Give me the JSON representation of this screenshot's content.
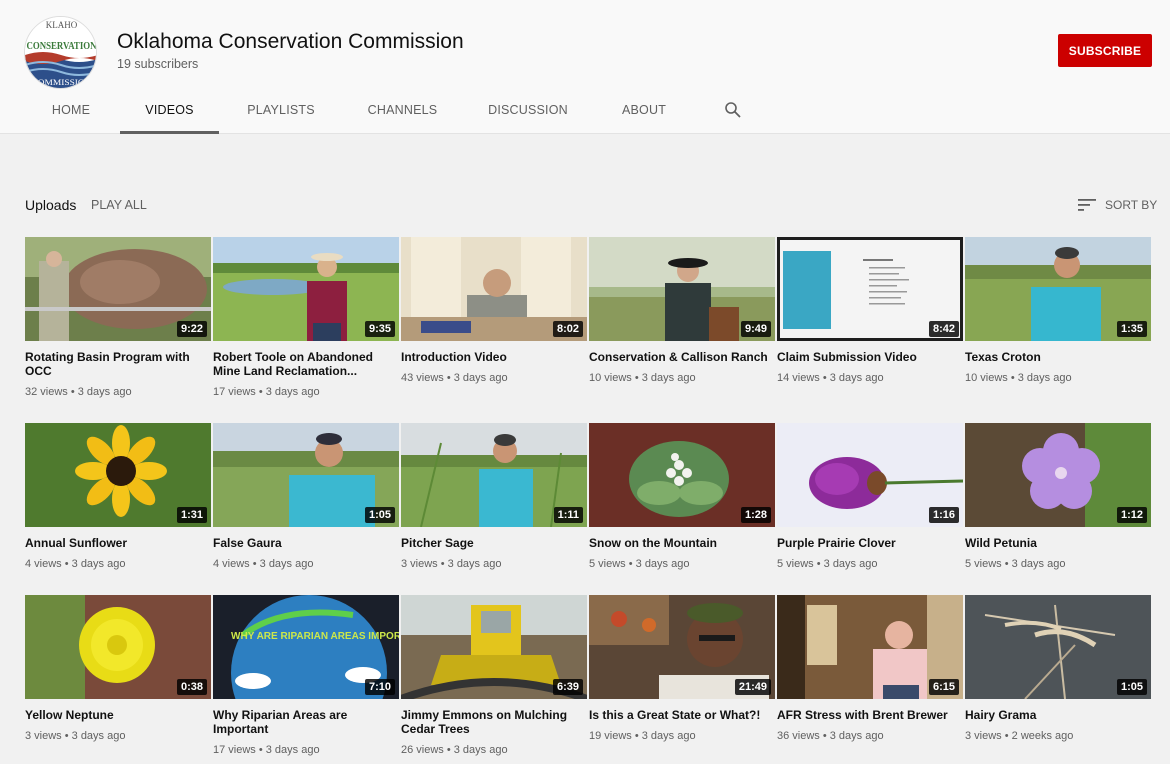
{
  "channel": {
    "logo_text_top": "KLAHO",
    "logo_text_mid": "CONSERVATION",
    "logo_text_bottom": "COMMISSION",
    "name": "Oklahoma Conservation Commission",
    "subscribers": "19 subscribers",
    "subscribe_label": "SUBSCRIBE"
  },
  "tabs": [
    {
      "label": "HOME"
    },
    {
      "label": "VIDEOS"
    },
    {
      "label": "PLAYLISTS"
    },
    {
      "label": "CHANNELS"
    },
    {
      "label": "DISCUSSION"
    },
    {
      "label": "ABOUT"
    }
  ],
  "uploads": {
    "title": "Uploads",
    "play_all": "PLAY ALL",
    "sort_by": "SORT BY"
  },
  "videos": [
    {
      "title": "Rotating Basin Program with OCC",
      "duration": "9:22",
      "meta": "32 views • 3 days ago"
    },
    {
      "title": "Robert Toole on Abandoned Mine Land Reclamation...",
      "duration": "9:35",
      "meta": "17 views • 3 days ago"
    },
    {
      "title": "Introduction Video",
      "duration": "8:02",
      "meta": "43 views • 3 days ago"
    },
    {
      "title": "Conservation & Callison Ranch",
      "duration": "9:49",
      "meta": "10 views • 3 days ago"
    },
    {
      "title": "Claim Submission Video",
      "duration": "8:42",
      "meta": "14 views • 3 days ago"
    },
    {
      "title": "Texas Croton",
      "duration": "1:35",
      "meta": "10 views • 3 days ago"
    },
    {
      "title": "Annual Sunflower",
      "duration": "1:31",
      "meta": "4 views • 3 days ago"
    },
    {
      "title": "False Gaura",
      "duration": "1:05",
      "meta": "4 views • 3 days ago"
    },
    {
      "title": "Pitcher Sage",
      "duration": "1:11",
      "meta": "3 views • 3 days ago"
    },
    {
      "title": "Snow on the Mountain",
      "duration": "1:28",
      "meta": "5 views • 3 days ago"
    },
    {
      "title": "Purple Prairie Clover",
      "duration": "1:16",
      "meta": "5 views • 3 days ago"
    },
    {
      "title": "Wild Petunia",
      "duration": "1:12",
      "meta": "5 views • 3 days ago"
    },
    {
      "title": "Yellow Neptune",
      "duration": "0:38",
      "meta": "3 views • 3 days ago"
    },
    {
      "title": "Why Riparian Areas are Important",
      "duration": "7:10",
      "meta": "17 views • 3 days ago",
      "thumb_text": "WHY ARE RIPARIAN AREAS IMPORTANT"
    },
    {
      "title": "Jimmy Emmons on Mulching Cedar Trees",
      "duration": "6:39",
      "meta": "26 views • 3 days ago"
    },
    {
      "title": "Is this a Great State or What?!",
      "duration": "21:49",
      "meta": "19 views • 3 days ago"
    },
    {
      "title": "AFR Stress with Brent Brewer",
      "duration": "6:15",
      "meta": "36 views • 3 days ago"
    },
    {
      "title": "Hairy Grama",
      "duration": "1:05",
      "meta": "3 views • 2 weeks ago"
    }
  ],
  "colors": {
    "subscribe": "#cc0000",
    "background": "#f1f1f1",
    "header": "#f9f9f9"
  }
}
